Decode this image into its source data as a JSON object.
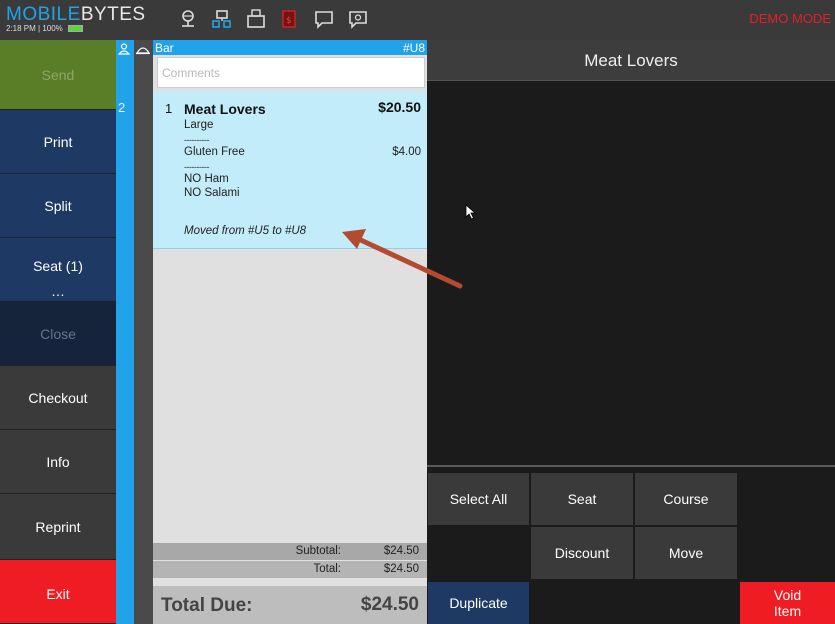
{
  "topbar": {
    "brand_part1": "MOBILE",
    "brand_part2": "BYTES",
    "time": "2:18 PM",
    "battery": "100%",
    "mode_label": "DEMO MODE",
    "icons": [
      "network-icon",
      "tables-icon",
      "printer-icon",
      "red-tag-icon",
      "chat-icon",
      "server-icon"
    ]
  },
  "left_buttons": [
    {
      "label": "Send",
      "state": "disabled"
    },
    {
      "label": "Print"
    },
    {
      "label": "Split"
    },
    {
      "label": "Seat (1)",
      "extra": "…"
    },
    {
      "label": "Close",
      "state": "disabled"
    },
    {
      "label": "Checkout"
    },
    {
      "label": "Info"
    },
    {
      "label": "Reprint"
    },
    {
      "label": "Exit"
    }
  ],
  "seat": {
    "number": "2"
  },
  "order": {
    "location": "Bar",
    "ticket": "#U8",
    "comments_placeholder": "Comments",
    "item": {
      "qty": "1",
      "name": "Meat Lovers",
      "price": "$20.50",
      "size": "Large",
      "separator": "----------",
      "option": "Gluten Free",
      "option_price": "$4.00",
      "remove1": "NO Ham",
      "remove2": "NO Salami",
      "note": "Moved from #U5 to #U8"
    },
    "subtotal_label": "Subtotal:",
    "subtotal": "$24.50",
    "total_label": "Total:",
    "total": "$24.50",
    "total_due_label": "Total Due:",
    "total_due": "$24.50"
  },
  "detail": {
    "title": "Meat Lovers"
  },
  "actions": {
    "select_all": "Select All",
    "seat": "Seat",
    "course": "Course",
    "discount": "Discount",
    "move": "Move",
    "duplicate": "Duplicate",
    "void": "Void Item"
  },
  "colors": {
    "accent": "#20a3e8",
    "send": "#5a7d28",
    "nav_blue": "#1e3a64",
    "exit_red": "#f01c24",
    "arrow": "#b44a2f"
  }
}
